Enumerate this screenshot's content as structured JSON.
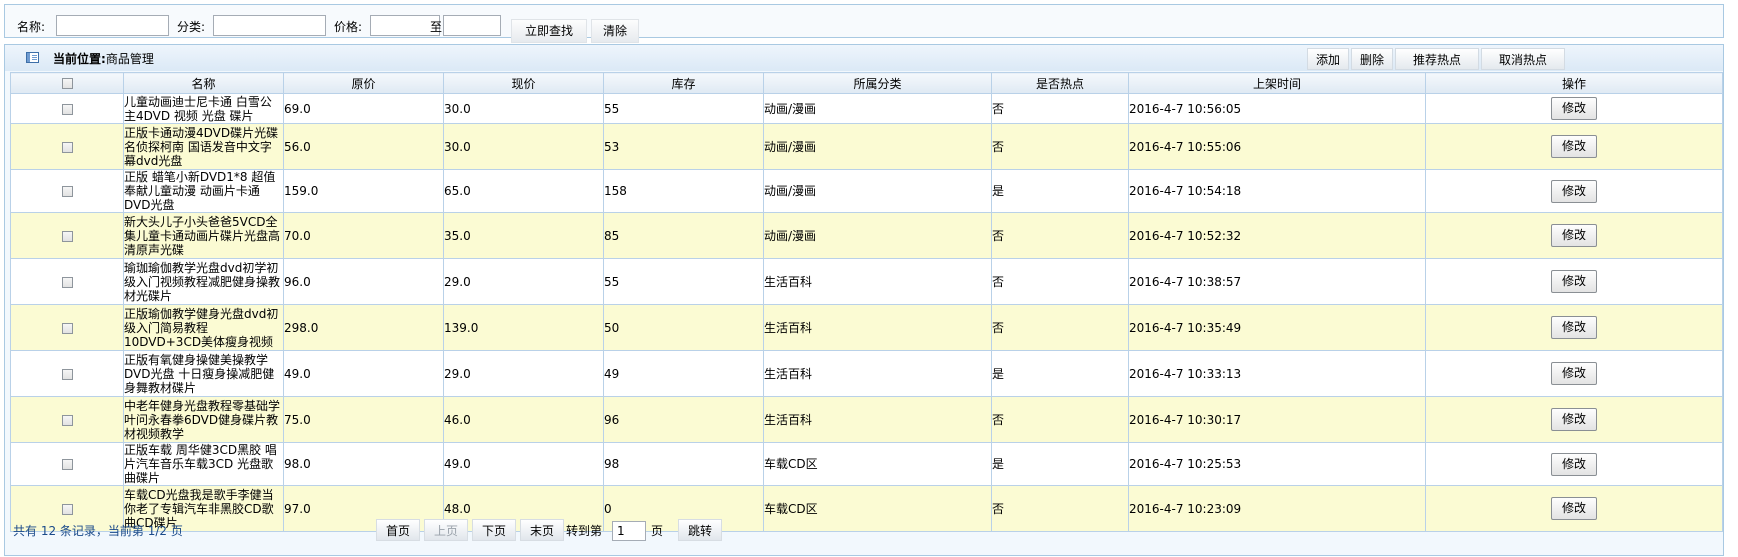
{
  "search": {
    "name_label": "名称:",
    "category_label": "分类:",
    "price_label": "价格:",
    "range_to": "至",
    "name_value": "",
    "category_value": "",
    "price_min_value": "",
    "price_max_value": "",
    "search_button": "立即查找",
    "clear_button": "清除"
  },
  "panel": {
    "location_label": "当前位置:",
    "location_value": "商品管理",
    "actions": {
      "add": "添加",
      "delete": "删除",
      "recommend_hot": "推荐热点",
      "cancel_hot": "取消热点"
    }
  },
  "table": {
    "columns": [
      "名称",
      "原价",
      "现价",
      "库存",
      "所属分类",
      "是否热点",
      "上架时间",
      "操作"
    ],
    "edit_label": "修改",
    "rows": [
      {
        "name": "儿童动画迪士尼卡通 白雪公主4DVD 视频 光盘 碟片",
        "original_price": "69.0",
        "current_price": "30.0",
        "stock": "55",
        "category": "动画/漫画",
        "hot": "否",
        "listed_time": "2016-4-7 10:56:05"
      },
      {
        "name": "正版卡通动漫4DVD碟片光碟 名侦探柯南 国语发音中文字幕dvd光盘",
        "original_price": "56.0",
        "current_price": "30.0",
        "stock": "53",
        "category": "动画/漫画",
        "hot": "否",
        "listed_time": "2016-4-7 10:55:06"
      },
      {
        "name": "正版 蜡笔小新DVD1*8 超值奉献儿童动漫 动画片卡通DVD光盘",
        "original_price": "159.0",
        "current_price": "65.0",
        "stock": "158",
        "category": "动画/漫画",
        "hot": "是",
        "listed_time": "2016-4-7 10:54:18"
      },
      {
        "name": "新大头儿子小头爸爸5VCD全集儿童卡通动画片碟片光盘高清原声光碟",
        "original_price": "70.0",
        "current_price": "35.0",
        "stock": "85",
        "category": "动画/漫画",
        "hot": "否",
        "listed_time": "2016-4-7 10:52:32"
      },
      {
        "name": "瑜珈瑜伽教学光盘dvd初学初级入门视频教程减肥健身操教材光碟片",
        "original_price": "96.0",
        "current_price": "29.0",
        "stock": "55",
        "category": "生活百科",
        "hot": "否",
        "listed_time": "2016-4-7 10:38:57"
      },
      {
        "name": "正版瑜伽教学健身光盘dvd初级入门简易教程 10DVD+3CD美体瘦身视频",
        "original_price": "298.0",
        "current_price": "139.0",
        "stock": "50",
        "category": "生活百科",
        "hot": "否",
        "listed_time": "2016-4-7 10:35:49"
      },
      {
        "name": "正版有氧健身操健美操教学DVD光盘 十日瘦身操减肥健身舞教材碟片",
        "original_price": "49.0",
        "current_price": "29.0",
        "stock": "49",
        "category": "生活百科",
        "hot": "是",
        "listed_time": "2016-4-7 10:33:13"
      },
      {
        "name": "中老年健身光盘教程零基础学叶问永春拳6DVD健身碟片教材视频教学",
        "original_price": "75.0",
        "current_price": "46.0",
        "stock": "96",
        "category": "生活百科",
        "hot": "否",
        "listed_time": "2016-4-7 10:30:17"
      },
      {
        "name": "正版车载 周华健3CD黑胶 唱片汽车音乐车载3CD 光盘歌曲碟片",
        "original_price": "98.0",
        "current_price": "49.0",
        "stock": "98",
        "category": "车载CD区",
        "hot": "是",
        "listed_time": "2016-4-7 10:25:53"
      },
      {
        "name": "车载CD光盘我是歌手李健当你老了专辑汽车非黑胶CD歌曲CD碟片",
        "original_price": "97.0",
        "current_price": "48.0",
        "stock": "0",
        "category": "车载CD区",
        "hot": "否",
        "listed_time": "2016-4-7 10:23:09"
      }
    ]
  },
  "pager": {
    "summary": "共有 12 条记录，当前第 1/2 页",
    "first": "首页",
    "prev": "上页",
    "next": "下页",
    "last": "末页",
    "goto_label": "转到第",
    "goto_value": "1",
    "page_unit": "页",
    "jump": "跳转"
  }
}
